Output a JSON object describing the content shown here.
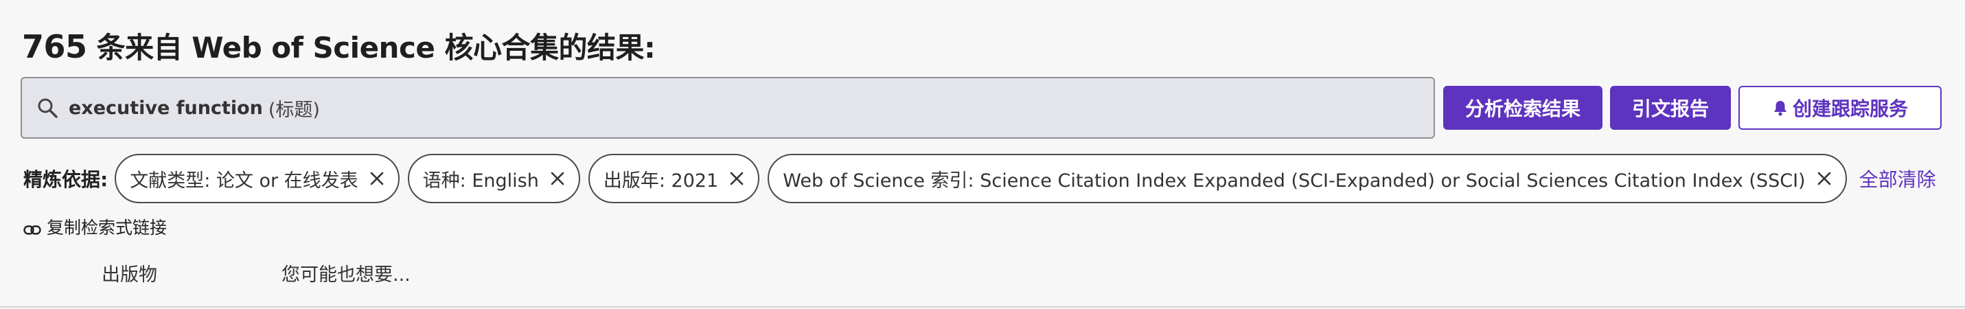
{
  "header": {
    "count": "765",
    "title_rest": " 条来自 Web of Science 核心合集的结果:"
  },
  "search": {
    "term": "executive function",
    "field": "(标题)"
  },
  "actions": {
    "analyze_label": "分析检索结果",
    "citation_report_label": "引文报告",
    "create_alert_label": "创建跟踪服务"
  },
  "filters": {
    "label": "精炼依据:",
    "chips": [
      {
        "label": "文献类型: 论文 or 在线发表"
      },
      {
        "label": "语种: English"
      },
      {
        "label": "出版年: 2021"
      },
      {
        "label": "Web of Science 索引: Science Citation Index Expanded (SCI-Expanded) or Social Sciences Citation Index (SSCI)"
      }
    ],
    "clear_all_label": "全部清除"
  },
  "copy_link": {
    "label": "复制检索式链接"
  },
  "tabs": {
    "publications": "出版物",
    "you_may_also_like": "您可能也想要..."
  },
  "colors": {
    "accent": "#5e33bf",
    "search_bg": "#e4e5ea",
    "page_bg": "#f7f7f7"
  },
  "icons": [
    "search-icon",
    "bell-icon",
    "close-icon",
    "link-icon"
  ]
}
